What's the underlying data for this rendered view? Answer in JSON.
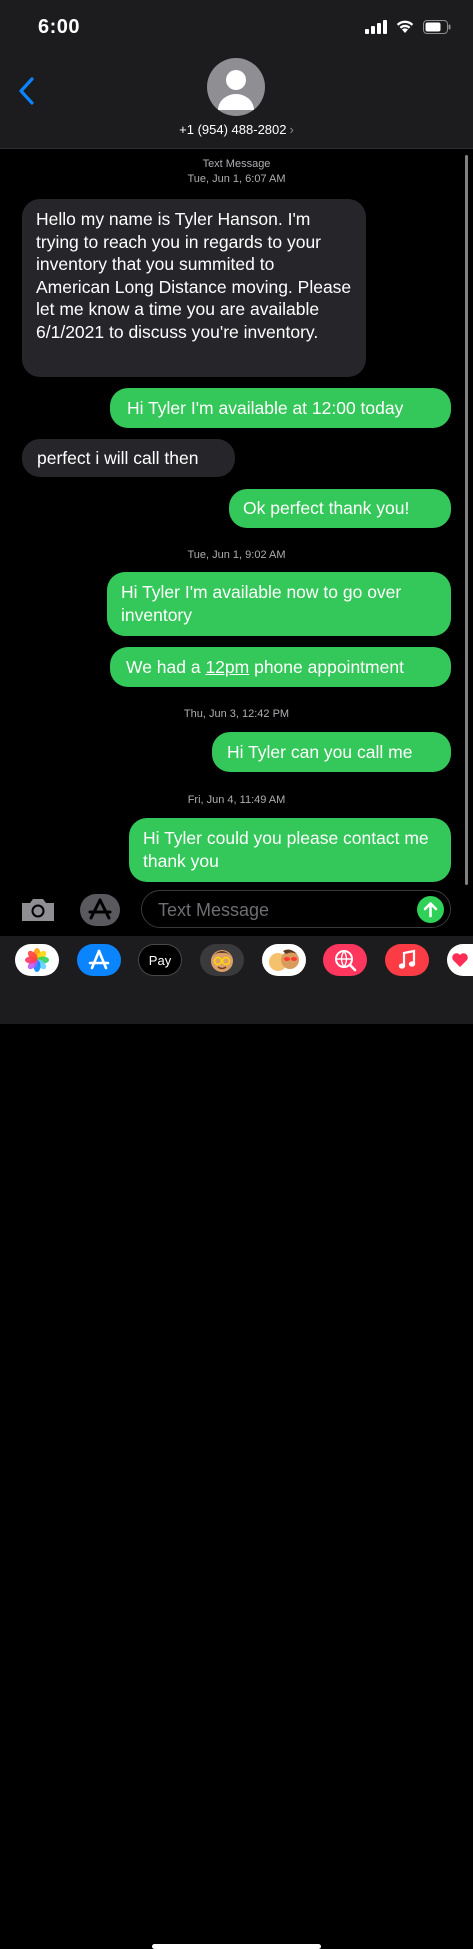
{
  "status_bar": {
    "time": "6:00"
  },
  "header": {
    "phone": "+1 (954) 488-2802",
    "chevron": "›",
    "back_icon": "chevron-left-icon"
  },
  "thread": {
    "header_label": "Text Message",
    "timestamps": [
      "Tue, Jun 1, 6:07 AM",
      "Tue, Jun 1, 9:02 AM",
      "Thu, Jun 3, 12:42 PM",
      "Fri, Jun 4, 11:49 AM"
    ],
    "messages": [
      {
        "dir": "in",
        "text": "Hello my name is Tyler Hanson. I'm trying to reach you in regards to your inventory that you summited to American Long Distance moving. Please let me know a time you are available 6/1/2021 to discuss you're inventory."
      },
      {
        "dir": "out",
        "text": "Hi Tyler I'm available at 12:00 today"
      },
      {
        "dir": "in",
        "text": "perfect i will call then"
      },
      {
        "dir": "out",
        "text": "Ok perfect thank you!"
      },
      {
        "dir": "out",
        "text": "Hi Tyler I'm available now to go over inventory"
      },
      {
        "dir": "out",
        "text_before": "We had a ",
        "text_link": "12pm",
        "text_after": " phone appointment"
      },
      {
        "dir": "out",
        "text": "Hi Tyler can you call me"
      },
      {
        "dir": "out",
        "text": "Hi Tyler could you please contact me thank you"
      }
    ]
  },
  "composer": {
    "placeholder": "Text Message"
  },
  "app_tray": {
    "apple_pay_label": "Pay",
    "apple_pay_glyph": ""
  },
  "colors": {
    "outgoing": "#34c759",
    "incoming": "#26252a",
    "accent": "#0a84ff"
  }
}
